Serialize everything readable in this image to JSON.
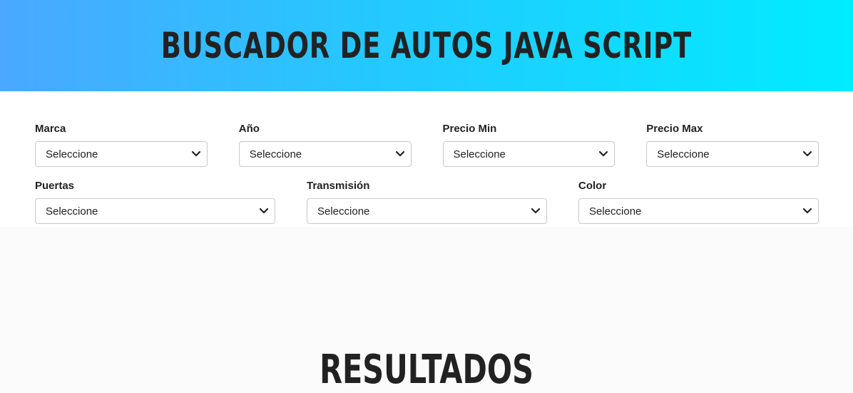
{
  "header": {
    "title": "Buscador de Autos Java Script"
  },
  "filters": {
    "row1": [
      {
        "label": "Marca",
        "value": "Seleccione"
      },
      {
        "label": "Año",
        "value": "Seleccione"
      },
      {
        "label": "Precio Min",
        "value": "Seleccione"
      },
      {
        "label": "Precio Max",
        "value": "Seleccione"
      }
    ],
    "row2": [
      {
        "label": "Puertas",
        "value": "Seleccione"
      },
      {
        "label": "Transmisión",
        "value": "Seleccione"
      },
      {
        "label": "Color",
        "value": "Seleccione"
      }
    ]
  },
  "results": {
    "title": "Resultados"
  },
  "icons": {
    "select_chevron": "chevron-down-icon"
  },
  "colors": {
    "header_gradient_start": "#4aa8ff",
    "header_gradient_end": "#00ecff",
    "text": "#222222"
  }
}
